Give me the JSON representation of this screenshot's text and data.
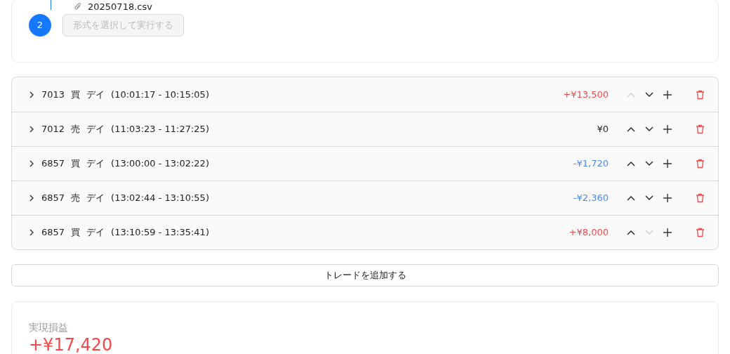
{
  "import_card": {
    "file_name": "20250718.csv",
    "step": "2",
    "run_button": {
      "label": "形式を選択して実行する",
      "disabled": true
    }
  },
  "trades": [
    {
      "code": "7013",
      "side": "買",
      "style": "デイ",
      "time": "(10:01:17 - 10:15:05)",
      "pnl": "+¥13,500",
      "kind": "gain",
      "up_disabled": true,
      "down_disabled": false
    },
    {
      "code": "7012",
      "side": "売",
      "style": "デイ",
      "time": "(11:03:23 - 11:27:25)",
      "pnl": "¥0",
      "kind": "flat",
      "up_disabled": false,
      "down_disabled": false
    },
    {
      "code": "6857",
      "side": "買",
      "style": "デイ",
      "time": "(13:00:00 - 13:02:22)",
      "pnl": "-¥1,720",
      "kind": "loss",
      "up_disabled": false,
      "down_disabled": false
    },
    {
      "code": "6857",
      "side": "売",
      "style": "デイ",
      "time": "(13:02:44 - 13:10:55)",
      "pnl": "-¥2,360",
      "kind": "loss",
      "up_disabled": false,
      "down_disabled": false
    },
    {
      "code": "6857",
      "side": "買",
      "style": "デイ",
      "time": "(13:10:59 - 13:35:41)",
      "pnl": "+¥8,000",
      "kind": "gain",
      "up_disabled": false,
      "down_disabled": true
    }
  ],
  "add_trade_button": "トレードを追加する",
  "summary": {
    "label": "実現損益",
    "value": "+¥17,420",
    "kind": "gain"
  }
}
